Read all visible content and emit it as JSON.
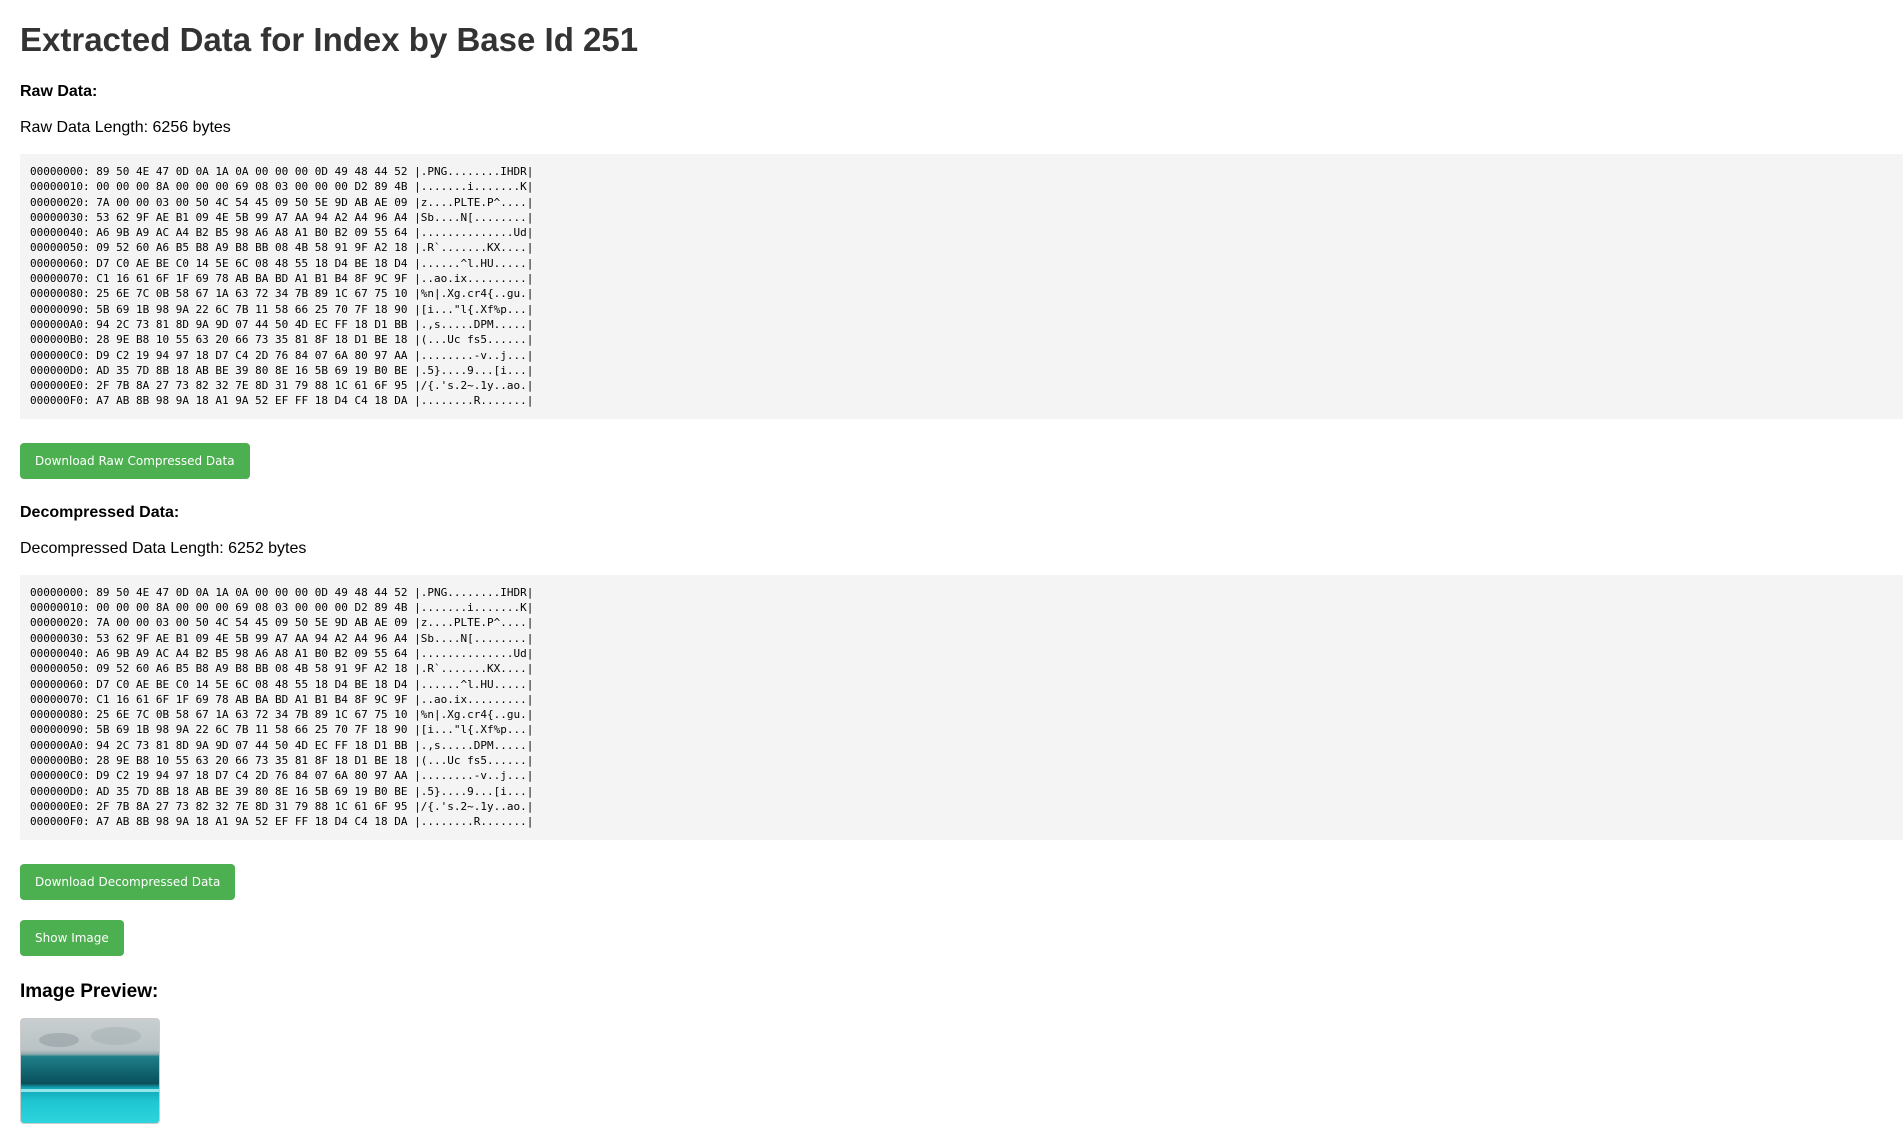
{
  "page": {
    "title": "Extracted Data for Index by Base Id 251"
  },
  "raw": {
    "heading": "Raw Data:",
    "length_text": "Raw Data Length: 6256 bytes",
    "hex_dump": "00000000: 89 50 4E 47 0D 0A 1A 0A 00 00 00 0D 49 48 44 52 |.PNG........IHDR|\n00000010: 00 00 00 8A 00 00 00 69 08 03 00 00 00 D2 89 4B |.......i.......K|\n00000020: 7A 00 00 03 00 50 4C 54 45 09 50 5E 9D AB AE 09 |z....PLTE.P^....|\n00000030: 53 62 9F AE B1 09 4E 5B 99 A7 AA 94 A2 A4 96 A4 |Sb....N[........|\n00000040: A6 9B A9 AC A4 B2 B5 98 A6 A8 A1 B0 B2 09 55 64 |..............Ud|\n00000050: 09 52 60 A6 B5 B8 A9 B8 BB 08 4B 58 91 9F A2 18 |.R`.......KX....|\n00000060: D7 C0 AE BE C0 14 5E 6C 08 48 55 18 D4 BE 18 D4 |......^l.HU.....|\n00000070: C1 16 61 6F 1F 69 78 AB BA BD A1 B1 B4 8F 9C 9F |..ao.ix.........|\n00000080: 25 6E 7C 0B 58 67 1A 63 72 34 7B 89 1C 67 75 10 |%n|.Xg.cr4{..gu.|\n00000090: 5B 69 1B 98 9A 22 6C 7B 11 58 66 25 70 7F 18 90 |[i...\"l{.Xf%p...|\n000000A0: 94 2C 73 81 8D 9A 9D 07 44 50 4D EC FF 18 D1 BB |.,s.....DPM.....|\n000000B0: 28 9E B8 10 55 63 20 66 73 35 81 8F 18 D1 BE 18 |(...Uc fs5......|\n000000C0: D9 C2 19 94 97 18 D7 C4 2D 76 84 07 6A 80 97 AA |........-v..j...|\n000000D0: AD 35 7D 8B 18 AB BE 39 80 8E 16 5B 69 19 B0 BE |.5}....9...[i...|\n000000E0: 2F 7B 8A 27 73 82 32 7E 8D 31 79 88 1C 61 6F 95 |/{.'s.2~.1y..ao.|\n000000F0: A7 AB 8B 98 9A 18 A1 9A 52 EF FF 18 D4 C4 18 DA |........R.......|",
    "download_label": "Download Raw Compressed Data"
  },
  "decompressed": {
    "heading": "Decompressed Data:",
    "length_text": "Decompressed Data Length: 6252 bytes",
    "hex_dump": "00000000: 89 50 4E 47 0D 0A 1A 0A 00 00 00 0D 49 48 44 52 |.PNG........IHDR|\n00000010: 00 00 00 8A 00 00 00 69 08 03 00 00 00 D2 89 4B |.......i.......K|\n00000020: 7A 00 00 03 00 50 4C 54 45 09 50 5E 9D AB AE 09 |z....PLTE.P^....|\n00000030: 53 62 9F AE B1 09 4E 5B 99 A7 AA 94 A2 A4 96 A4 |Sb....N[........|\n00000040: A6 9B A9 AC A4 B2 B5 98 A6 A8 A1 B0 B2 09 55 64 |..............Ud|\n00000050: 09 52 60 A6 B5 B8 A9 B8 BB 08 4B 58 91 9F A2 18 |.R`.......KX....|\n00000060: D7 C0 AE BE C0 14 5E 6C 08 48 55 18 D4 BE 18 D4 |......^l.HU.....|\n00000070: C1 16 61 6F 1F 69 78 AB BA BD A1 B1 B4 8F 9C 9F |..ao.ix.........|\n00000080: 25 6E 7C 0B 58 67 1A 63 72 34 7B 89 1C 67 75 10 |%n|.Xg.cr4{..gu.|\n00000090: 5B 69 1B 98 9A 22 6C 7B 11 58 66 25 70 7F 18 90 |[i...\"l{.Xf%p...|\n000000A0: 94 2C 73 81 8D 9A 9D 07 44 50 4D EC FF 18 D1 BB |.,s.....DPM.....|\n000000B0: 28 9E B8 10 55 63 20 66 73 35 81 8F 18 D1 BE 18 |(...Uc fs5......|\n000000C0: D9 C2 19 94 97 18 D7 C4 2D 76 84 07 6A 80 97 AA |........-v..j...|\n000000D0: AD 35 7D 8B 18 AB BE 39 80 8E 16 5B 69 19 B0 BE |.5}....9...[i...|\n000000E0: 2F 7B 8A 27 73 82 32 7E 8D 31 79 88 1C 61 6F 95 |/{.'s.2~.1y..ao.|\n000000F0: A7 AB 8B 98 9A 18 A1 9A 52 EF FF 18 D4 C4 18 DA |........R.......|",
    "download_label": "Download Decompressed Data"
  },
  "show_image_label": "Show Image",
  "preview": {
    "heading": "Image Preview:"
  },
  "colors": {
    "button": "#4caf50",
    "code_bg": "#f4f4f4",
    "title": "#333333"
  }
}
